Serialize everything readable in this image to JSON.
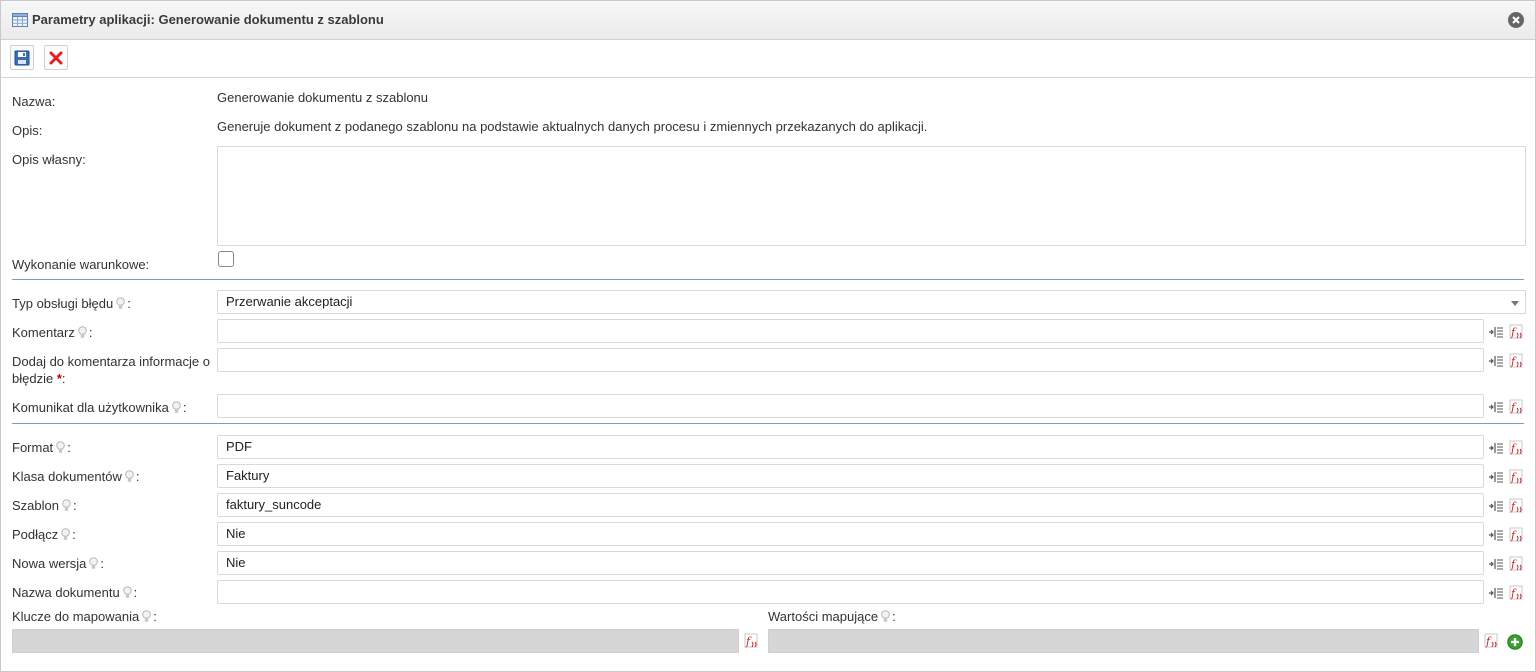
{
  "window": {
    "title": "Parametry aplikacji: Generowanie dokumentu z szablonu"
  },
  "toolbar": {
    "save": "save-icon",
    "cancel": "cancel-icon"
  },
  "info": {
    "name_label": "Nazwa:",
    "name_value": "Generowanie dokumentu z szablonu",
    "desc_label": "Opis:",
    "desc_value": "Generuje dokument z podanego szablonu na podstawie aktualnych danych procesu i zmiennych przekazanych do aplikacji.",
    "own_desc_label": "Opis własny:",
    "own_desc_value": "",
    "conditional_label": "Wykonanie warunkowe:",
    "conditional_checked": false
  },
  "errors": {
    "error_type_label": "Typ obsługi błędu",
    "error_type_value": "Przerwanie akceptacji",
    "comment_label": "Komentarz",
    "comment_value": "",
    "add_info_label_1": "Dodaj do komentarza informacje o",
    "add_info_label_2": "błędzie",
    "add_info_required": "*",
    "add_info_value": "",
    "user_msg_label": "Komunikat dla użytkownika",
    "user_msg_value": ""
  },
  "params": {
    "format_label": "Format",
    "format_value": "PDF",
    "doc_class_label": "Klasa dokumentów",
    "doc_class_value": "Faktury",
    "template_label": "Szablon",
    "template_value": "faktury_suncode",
    "attach_label": "Podłącz",
    "attach_value": "Nie",
    "new_version_label": "Nowa wersja",
    "new_version_value": "Nie",
    "doc_name_label": "Nazwa dokumentu",
    "doc_name_value": ""
  },
  "mapping": {
    "keys_label": "Klucze do mapowania",
    "values_label": "Wartości mapujące"
  },
  "colors": {
    "accent": "#7f9db9",
    "remove": "#cc2222",
    "add": "#3aa030"
  }
}
